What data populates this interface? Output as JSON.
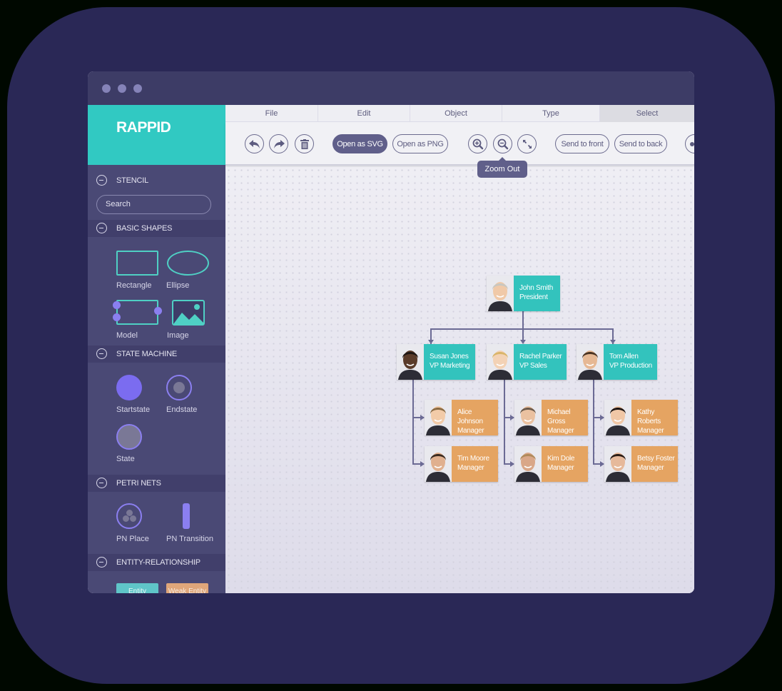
{
  "app": {
    "brand": "RAPPID"
  },
  "window_controls": [
    "dot",
    "dot",
    "dot"
  ],
  "menu": [
    "File",
    "Edit",
    "Object",
    "Type",
    "Select"
  ],
  "menu_active": "Select",
  "toolbar": {
    "undo_icon": "undo-icon",
    "redo_icon": "redo-icon",
    "delete_icon": "trash-icon",
    "open_svg": "Open as SVG",
    "open_png": "Open as PNG",
    "zoom_in_icon": "zoom-in-icon",
    "zoom_out_icon": "zoom-out-icon",
    "fit_icon": "fullscreen-icon",
    "send_front": "Send to front",
    "send_back": "Send to back",
    "tooltip": "Zoom Out"
  },
  "sidebar": {
    "stencil": "STENCIL",
    "search_placeholder": "Search",
    "sections": [
      {
        "title": "BASIC SHAPES",
        "items": [
          "Rectangle",
          "Ellipse",
          "Model",
          "Image"
        ]
      },
      {
        "title": "STATE MACHINE",
        "items": [
          "Startstate",
          "Endstate",
          "State"
        ]
      },
      {
        "title": "PETRI NETS",
        "items": [
          "PN Place",
          "PN Transition"
        ]
      },
      {
        "title": "ENTITY-RELATIONSHIP",
        "items": [
          "Entity",
          "Weak Entity"
        ]
      }
    ]
  },
  "colors": {
    "teal": "#33c3bd",
    "orange": "#e5a462",
    "sidebar": "#4a4975",
    "accent_purple": "#7b6cf0"
  },
  "org_chart": {
    "root": {
      "name": "John Smith",
      "title": "President"
    },
    "vps": [
      {
        "name": "Susan Jones",
        "title": "VP Marketing"
      },
      {
        "name": "Rachel Parker",
        "title": "VP Sales"
      },
      {
        "name": "Tom Allen",
        "title": "VP Production"
      }
    ],
    "managers": [
      {
        "name": "Alice Johnson",
        "title": "Manager"
      },
      {
        "name": "Tim Moore",
        "title": "Manager"
      },
      {
        "name": "Michael Gross",
        "title": "Manager"
      },
      {
        "name": "Kim Dole",
        "title": "Manager"
      },
      {
        "name": "Kathy Roberts",
        "title": "Manager"
      },
      {
        "name": "Betsy Foster",
        "title": "Manager"
      }
    ]
  }
}
